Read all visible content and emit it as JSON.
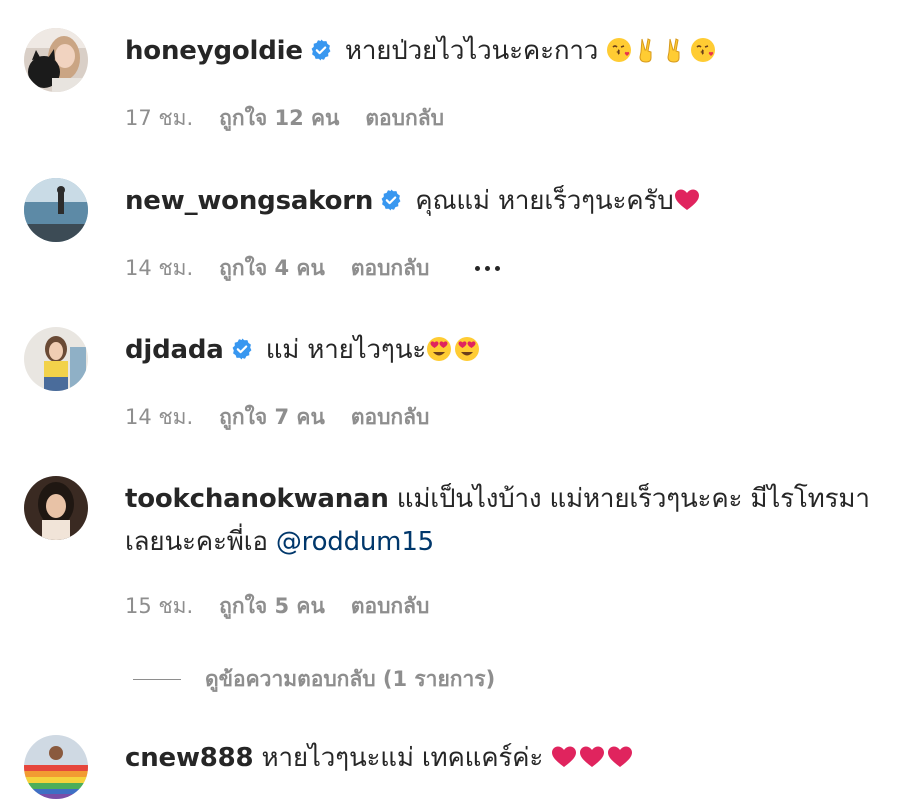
{
  "comments": [
    {
      "username": "honeygoldie",
      "verified": true,
      "text": "หายป่วยไวไวนะคะกาว",
      "emojis": [
        "kiss-emoji",
        "victory-hand-emoji",
        "victory-hand-emoji",
        "kiss-emoji"
      ],
      "time": "17 ชม.",
      "likes": "ถูกใจ 12 คน",
      "reply": "ตอบกลับ"
    },
    {
      "username": "new_wongsakorn",
      "verified": true,
      "text": "คุณแม่ หายเร็วๆนะครับ",
      "emojis": [
        "red-heart-emoji"
      ],
      "time": "14 ชม.",
      "likes": "ถูกใจ 4 คน",
      "reply": "ตอบกลับ"
    },
    {
      "username": "djdada",
      "verified": true,
      "text": "แม่ หายไวๆนะ",
      "emojis": [
        "heart-eyes-emoji",
        "heart-eyes-emoji"
      ],
      "time": "14 ชม.",
      "likes": "ถูกใจ 7 คน",
      "reply": "ตอบกลับ"
    },
    {
      "username": "tookchanokwanan",
      "verified": false,
      "text": "แม่เป็นไงบ้าง แม่หายเร็วๆนะคะ มีไรโทรมาเลยนะคะพี่เอ",
      "mention": "@roddum15",
      "time": "15 ชม.",
      "likes": "ถูกใจ 5 คน",
      "reply": "ตอบกลับ",
      "view_replies": "ดูข้อความตอบกลับ (1 รายการ)"
    },
    {
      "username": "cnew888",
      "verified": false,
      "text": "หายไวๆนะแม่ เทคแคร์ค่ะ",
      "emojis": [
        "red-heart-emoji",
        "red-heart-emoji",
        "red-heart-emoji"
      ]
    }
  ],
  "colors": {
    "text_primary": "#262626",
    "text_secondary": "#8e8e8e",
    "verified_badge": "#3897f0",
    "mention": "#00376b"
  }
}
